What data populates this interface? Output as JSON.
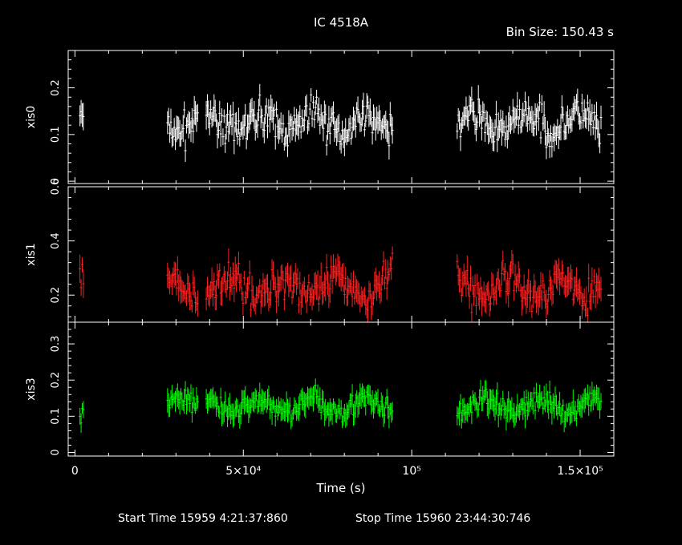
{
  "title": "IC 4518A",
  "bin_size_text": "Bin Size: 150.43 s",
  "footer": {
    "start": "Start Time 15959  4:21:37:860",
    "stop": "Stop Time 15960 23:44:30:746"
  },
  "chart_data": {
    "type": "scatter",
    "xlabel": "Time (s)",
    "xlim": [
      -2000,
      160000
    ],
    "x_ticks": [
      {
        "value": 0,
        "label": "0"
      },
      {
        "value": 50000,
        "label": "5×10⁴"
      },
      {
        "value": 100000,
        "label": "10⁵"
      },
      {
        "value": 150000,
        "label": "1.5×10⁵"
      }
    ],
    "bin_size": 150.43,
    "segments": [
      [
        1500,
        2700
      ],
      [
        27500,
        36500
      ],
      [
        39000,
        94500
      ],
      [
        113500,
        156500
      ]
    ],
    "panels": [
      {
        "name": "xis0",
        "color": "#ffffff",
        "ylim": [
          -0.005,
          0.28
        ],
        "yticks": [
          0,
          0.1,
          0.2
        ],
        "ylabels": [
          "0",
          "0.1",
          "0.2"
        ],
        "mean": 0.125,
        "spread": 0.032,
        "error": 0.022
      },
      {
        "name": "xis1",
        "color": "#ff2020",
        "ylim": [
          0.1,
          0.6
        ],
        "yticks": [
          0.2,
          0.4,
          0.6
        ],
        "ylabels": [
          "0.2",
          "0.4",
          "0.6"
        ],
        "mean": 0.23,
        "spread": 0.06,
        "error": 0.04
      },
      {
        "name": "xis3",
        "color": "#00ff00",
        "ylim": [
          -0.01,
          0.36
        ],
        "yticks": [
          0,
          0.1,
          0.2,
          0.3
        ],
        "ylabels": [
          "0",
          "0.1",
          "0.2",
          "0.3"
        ],
        "mean": 0.13,
        "spread": 0.028,
        "error": 0.025
      }
    ]
  }
}
